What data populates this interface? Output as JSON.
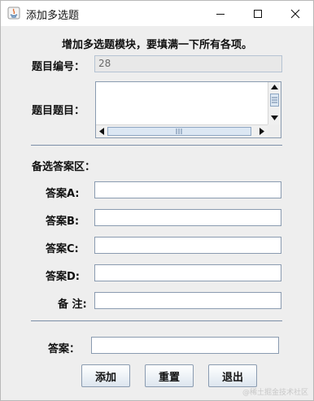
{
  "window": {
    "title": "添加多选题",
    "controls": {
      "minimize": "minimize",
      "maximize": "maximize",
      "close": "close"
    }
  },
  "form": {
    "heading": "增加多选题模块，要填满一下所有各项。",
    "id_label": "题目编号：",
    "id_value": "28",
    "question_label": "题目题目：",
    "question_value": "",
    "options_section_label": "备选答案区：",
    "answer_a_label": "答案A:",
    "answer_b_label": "答案B:",
    "answer_c_label": "答案C:",
    "answer_d_label": "答案D:",
    "note_label": "备 注:",
    "answer_label": "答案：",
    "answer_a_value": "",
    "answer_b_value": "",
    "answer_c_value": "",
    "answer_d_value": "",
    "note_value": "",
    "answer_value": ""
  },
  "buttons": {
    "add": "添加",
    "reset": "重置",
    "exit": "退出"
  },
  "watermark": "@稀土掘金技术社区",
  "colors": {
    "panel_background": "#eeeeee",
    "field_border": "#8a9bb0",
    "separator": "#7c8fa7"
  }
}
